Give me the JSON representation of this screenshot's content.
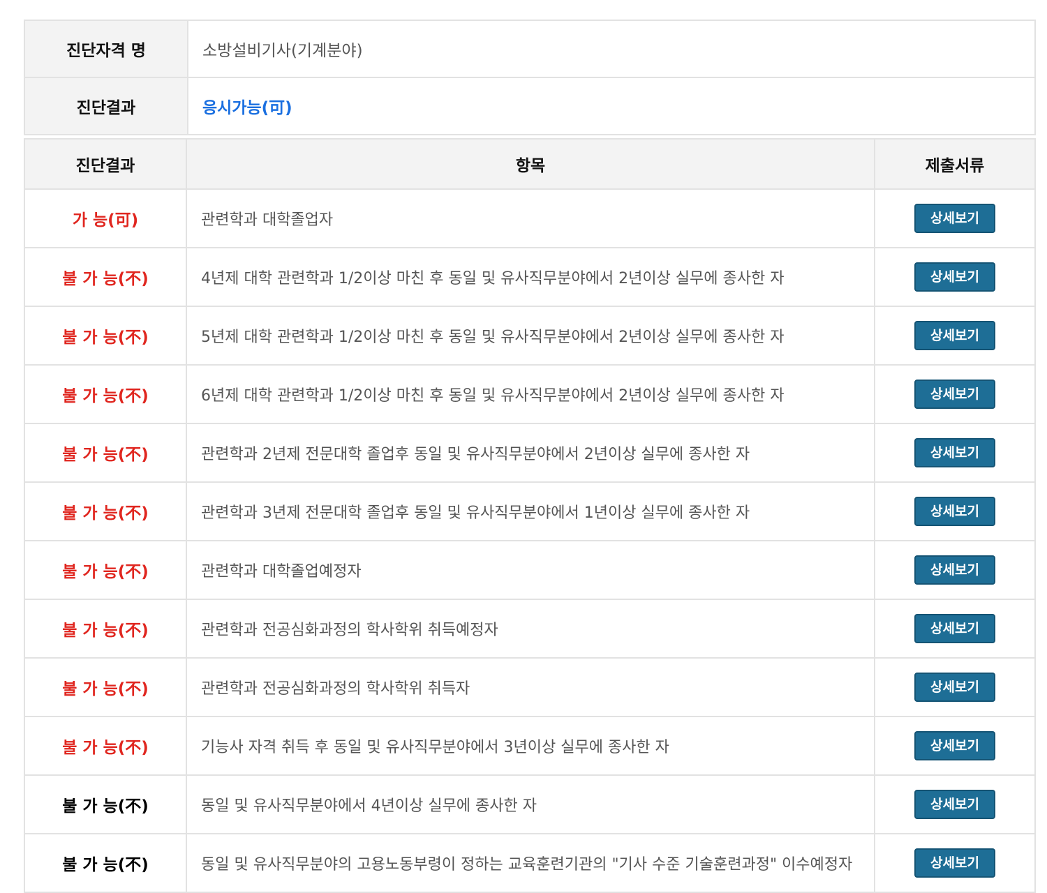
{
  "summary": {
    "qualification_label": "진단자격 명",
    "qualification_value": "소방설비기사(기계분야)",
    "result_label": "진단결과",
    "result_value": "응시가능(可)"
  },
  "table": {
    "headers": [
      "진단결과",
      "항목",
      "제출서류"
    ],
    "rows": [
      {
        "status": "가 능(可)",
        "ok": true,
        "item": "관련학과 대학졸업자",
        "button": "상세보기"
      },
      {
        "status": "불 가 능(不)",
        "ok": false,
        "item": "4년제 대학 관련학과 1/2이상 마친 후 동일 및 유사직무분야에서 2년이상 실무에 종사한 자",
        "button": "상세보기"
      },
      {
        "status": "불 가 능(不)",
        "ok": false,
        "item": "5년제 대학 관련학과 1/2이상 마친 후 동일 및 유사직무분야에서 2년이상 실무에 종사한 자",
        "button": "상세보기"
      },
      {
        "status": "불 가 능(不)",
        "ok": false,
        "item": "6년제 대학 관련학과 1/2이상 마친 후 동일 및 유사직무분야에서 2년이상 실무에 종사한 자",
        "button": "상세보기"
      },
      {
        "status": "불 가 능(不)",
        "ok": false,
        "item": "관련학과 2년제 전문대학 졸업후 동일 및 유사직무분야에서 2년이상 실무에 종사한 자",
        "button": "상세보기"
      },
      {
        "status": "불 가 능(不)",
        "ok": false,
        "item": "관련학과 3년제 전문대학 졸업후 동일 및 유사직무분야에서 1년이상 실무에 종사한 자",
        "button": "상세보기"
      },
      {
        "status": "불 가 능(不)",
        "ok": false,
        "item": "관련학과 대학졸업예정자",
        "button": "상세보기"
      },
      {
        "status": "불 가 능(不)",
        "ok": false,
        "item": "관련학과 전공심화과정의 학사학위 취득예정자",
        "button": "상세보기"
      },
      {
        "status": "불 가 능(不)",
        "ok": false,
        "item": "관련학과 전공심화과정의 학사학위 취득자",
        "button": "상세보기"
      },
      {
        "status": "불 가 능(不)",
        "ok": false,
        "item": "기능사 자격 취득 후 동일 및 유사직무분야에서 3년이상 실무에 종사한 자",
        "button": "상세보기"
      },
      {
        "status": "불 가 능(不)",
        "ok": false,
        "item": "동일 및 유사직무분야에서 4년이상 실무에 종사한 자",
        "button": "상세보기"
      },
      {
        "status": "불 가 능(不)",
        "ok": false,
        "item": "동일 및 유사직무분야의 고용노동부령이 정하는 교육훈련기관의 \"기사 수준 기술훈련과정\" 이수예정자",
        "button": "상세보기"
      }
    ]
  },
  "colors": {
    "possible": "#1a6fe0",
    "impossible": "#e0261f",
    "button_bg": "#1e6e96"
  }
}
